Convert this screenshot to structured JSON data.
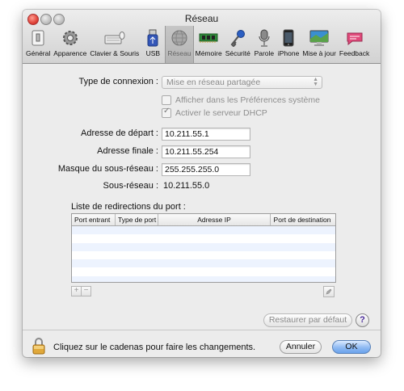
{
  "window": {
    "title": "Réseau"
  },
  "toolbar": {
    "items": [
      {
        "label": "Général",
        "icon": "light-switch-icon"
      },
      {
        "label": "Apparence",
        "icon": "gear-icon"
      },
      {
        "label": "Clavier & Souris",
        "icon": "keyboard-icon"
      },
      {
        "label": "USB",
        "icon": "usb-icon"
      },
      {
        "label": "Réseau",
        "icon": "globe-icon",
        "active": true
      },
      {
        "label": "Mémoire",
        "icon": "memory-chip-icon"
      },
      {
        "label": "Sécurité",
        "icon": "key-icon"
      },
      {
        "label": "Parole",
        "icon": "microphone-icon"
      },
      {
        "label": "iPhone",
        "icon": "iphone-icon"
      },
      {
        "label": "Mise à jour",
        "icon": "monitor-update-icon"
      },
      {
        "label": "Feedback",
        "icon": "feedback-icon"
      }
    ]
  },
  "form": {
    "connection_type_label": "Type de connexion :",
    "connection_type_value": "Mise en réseau partagée",
    "show_in_prefs_label": "Afficher dans les Préférences système",
    "show_in_prefs_checked": false,
    "dhcp_label": "Activer le serveur DHCP",
    "dhcp_checked": true,
    "start_address_label": "Adresse de départ :",
    "start_address_value": "10.211.55.1",
    "end_address_label": "Adresse finale :",
    "end_address_value": "10.211.55.254",
    "subnet_mask_label": "Masque du sous-réseau :",
    "subnet_mask_value": "255.255.255.0",
    "subnet_label": "Sous-réseau :",
    "subnet_value": "10.211.55.0"
  },
  "port_forwarding": {
    "label": "Liste de redirections du port :",
    "columns": [
      "Port entrant",
      "Type de port",
      "Adresse IP",
      "Port de destination"
    ],
    "rows": []
  },
  "buttons": {
    "add": "+",
    "remove": "−",
    "restore_defaults": "Restaurer par défaut",
    "help": "?",
    "cancel": "Annuler",
    "ok": "OK"
  },
  "footer": {
    "lock_message": "Cliquez sur le cadenas pour faire les changements."
  }
}
